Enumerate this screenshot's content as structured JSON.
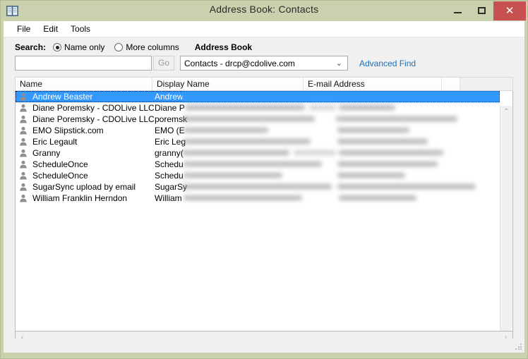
{
  "window": {
    "title": "Address Book: Contacts",
    "icon": "address-book-icon",
    "frame_color": "#c9d1ae",
    "controls": {
      "minimize": "–",
      "maximize": "□",
      "close": "✕"
    }
  },
  "menubar": {
    "items": [
      {
        "label": "File"
      },
      {
        "label": "Edit"
      },
      {
        "label": "Tools"
      }
    ]
  },
  "toolbar": {
    "search_label": "Search:",
    "radios": [
      {
        "label": "Name only",
        "checked": true
      },
      {
        "label": "More columns",
        "checked": false
      }
    ],
    "address_book_label": "Address Book",
    "search_input_value": "",
    "search_input_placeholder": "",
    "go_button": "Go",
    "address_book_select": {
      "selected": "Contacts - drcp@cdolive.com",
      "chevron": "⌄"
    },
    "advanced_find": "Advanced Find",
    "link_color": "#1f6fb5"
  },
  "list": {
    "columns": [
      {
        "label": "Name"
      },
      {
        "label": "Display Name"
      },
      {
        "label": "E-mail Address"
      },
      {
        "label": ""
      },
      {
        "label": ""
      }
    ],
    "selection_color": "#3399ff",
    "rows": [
      {
        "name": "Andrew Beaster",
        "display": "Andrew",
        "email": "",
        "selected": true
      },
      {
        "name": "Diane Poremsky - CDOLive LLC",
        "display": "Diane P",
        "email": "",
        "selected": false
      },
      {
        "name": "Diane Poremsky - CDOLive LLC",
        "display": "poremsk",
        "email": "",
        "selected": false
      },
      {
        "name": "EMO Slipstick.com",
        "display": "EMO (E",
        "email": "",
        "selected": false
      },
      {
        "name": "Eric Legault",
        "display": "Eric Leg",
        "email": "",
        "selected": false
      },
      {
        "name": "Granny",
        "display": "granny(",
        "email": "",
        "selected": false
      },
      {
        "name": "ScheduleOnce",
        "display": "Schedu",
        "email": "",
        "selected": false
      },
      {
        "name": "ScheduleOnce",
        "display": "Schedu",
        "email": "",
        "selected": false
      },
      {
        "name": "SugarSync upload by email",
        "display": "SugarSy",
        "email": "",
        "selected": false
      },
      {
        "name": "William Franklin Herndon",
        "display": "William",
        "email": "",
        "selected": false
      }
    ]
  },
  "scrollbars": {
    "vertical": {
      "up": "⌃",
      "down": "⌄"
    },
    "horizontal": {
      "left": "‹",
      "right": "›"
    }
  }
}
